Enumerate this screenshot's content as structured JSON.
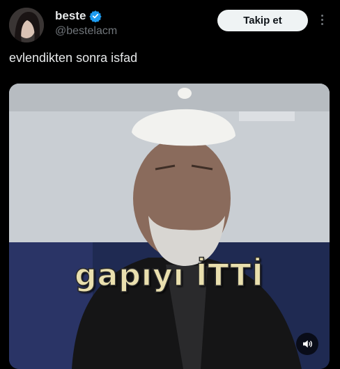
{
  "author": {
    "display_name": "beste",
    "handle": "@bestelacm",
    "verified": true,
    "verified_color": "#1d9bf0"
  },
  "actions": {
    "follow_label": "Takip et",
    "more_icon": "more-vertical-icon"
  },
  "post": {
    "text": "evlendikten sonra isfad"
  },
  "media": {
    "type": "video",
    "caption_text": "gapıyı İTTİ",
    "volume_icon": "volume-icon"
  }
}
